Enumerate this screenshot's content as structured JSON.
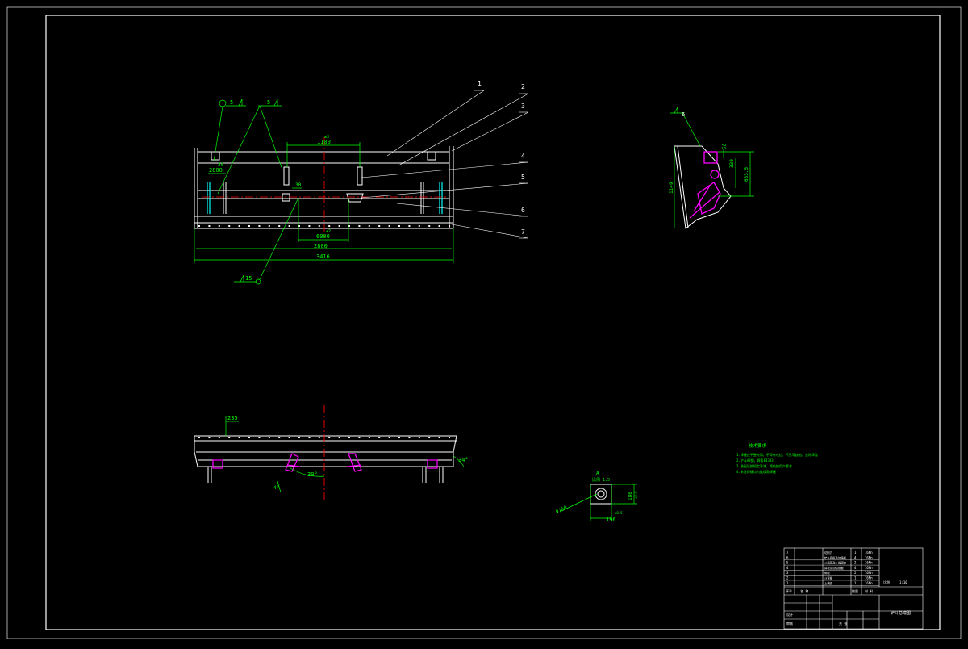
{
  "colors": {
    "background": "#000000",
    "frame": "#ffffff",
    "annotation": "#00ff00",
    "centerline": "#ff0000",
    "highlight": "#ff00ff",
    "accent": "#00ffff"
  },
  "front_view": {
    "dims": {
      "top_width": "1100",
      "top_tol": "±3",
      "left_pitch": "2800",
      "left_tol": "±5",
      "left_offset": "30",
      "center_small": "30",
      "mid_width": "6000",
      "mid_tol": "±2",
      "lower_width": "2800",
      "overall_width": "3416"
    },
    "weld_symbols": {
      "top_left": "5",
      "top_mid": "5",
      "bottom": "15"
    },
    "callouts": [
      "1",
      "2",
      "3",
      "4",
      "5",
      "6",
      "7"
    ]
  },
  "side_view": {
    "callout": "6",
    "dims": {
      "height": "1149",
      "upper": "75",
      "mid": "330",
      "tall": "633.5"
    }
  },
  "top_view": {
    "dims": {
      "left_offset": "235",
      "angle_center": "30°",
      "angle_right": "34°",
      "angle_left": "4°"
    }
  },
  "detail_view": {
    "label_top": "A",
    "label_scale": "比例 1:5",
    "dims": {
      "diameter": "Φ160",
      "width": "196",
      "width_tol": "±0.5",
      "height": "180",
      "height_tol": "±0.5"
    }
  },
  "notes": {
    "title": "技术要求",
    "lines": [
      "1.焊缝应平整光滑，不得有咬边、气孔等缺陷，去除焊渣",
      "2.铲斗A3钢，焊条E4303",
      "3.装配后按规定涂漆，颜色按用户要求",
      "4.未注焊缝均为连续角焊缝"
    ]
  },
  "title_block": {
    "rows": [
      {
        "no": "7",
        "name": "切削刃",
        "qty": "1",
        "mat": "16Mn"
      },
      {
        "no": "6",
        "name": "铲斗底板及加强板",
        "qty": "4",
        "mat": "16Mn"
      },
      {
        "no": "5",
        "name": "斗齿座及斗齿固定",
        "qty": "2",
        "mat": "16Mn"
      },
      {
        "no": "4",
        "name": "耳板及加强筋板",
        "qty": "4",
        "mat": "16Mn"
      },
      {
        "no": "3",
        "name": "侧板",
        "qty": "2",
        "mat": "16Mn"
      },
      {
        "no": "2",
        "name": "斗背板",
        "qty": "1",
        "mat": "16Mn"
      },
      {
        "no": "1",
        "name": "上横梁",
        "qty": "1",
        "mat": "16Mn"
      }
    ],
    "header": {
      "no": "序号",
      "name": "名 称",
      "qty": "数量",
      "mat": "材 料"
    },
    "drawing_title": "铲斗总成图",
    "scale_label": "比例",
    "scale": "1:10",
    "sheet": "共 张",
    "designer": "设计",
    "checker": "审核"
  }
}
